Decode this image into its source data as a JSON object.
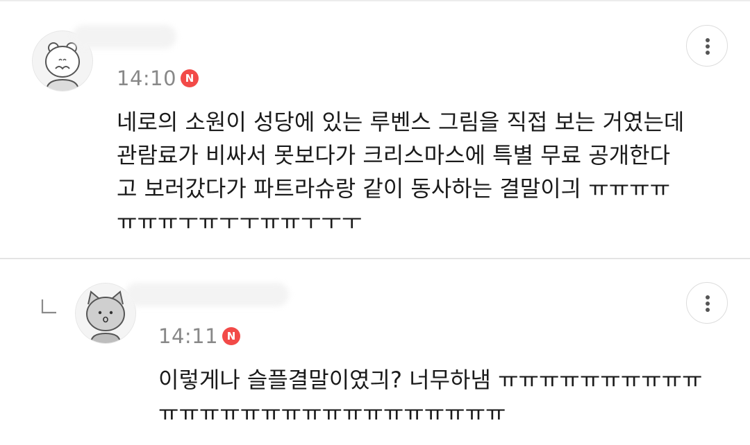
{
  "comments": [
    {
      "time": "14:10",
      "badge": "N",
      "text_lines": [
        "네로의 소원이 성당에 있는 루벤스 그림을 직접 보는 거였는데",
        "관람료가 비싸서 못보다가 크리스마스에 특별 무료 공개한다",
        "고 보러갔다가 파트라슈랑 같이 동사하는 결말이긔 ㅠㅠㅠㅠ",
        "ㅠㅠㅠㅜㅠㅜㅜㅠㅠㅜㅜㅜ"
      ],
      "avatar_icon": "hamster-avatar-icon",
      "more_icon": "more-vertical-icon"
    },
    {
      "time": "14:11",
      "badge": "N",
      "text_lines": [
        "이렇게나 슬플결말이였긔? 너무하냄 ㅠㅠㅠㅠㅠㅠㅠㅠㅠㅠ",
        "ㅠㅠㅠㅠㅠㅠㅠㅠㅠㅠㅠㅠㅠㅠㅠㅠㅠ"
      ],
      "avatar_icon": "cat-avatar-icon",
      "reply_icon": "reply-indicator-icon",
      "more_icon": "more-vertical-icon"
    }
  ],
  "colors": {
    "badge": "#f24a48",
    "time": "#888888",
    "text": "#1a1a1a",
    "divider": "#e4e4e4"
  }
}
